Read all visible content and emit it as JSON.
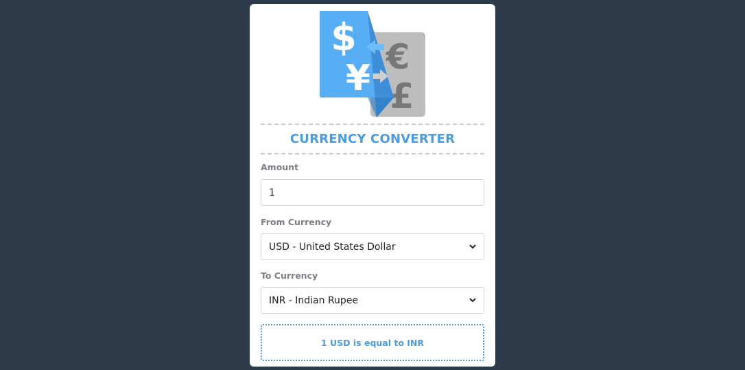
{
  "app": {
    "title": "CURRENCY CONVERTER",
    "logo_icon": "currency-exchange-icon"
  },
  "amount": {
    "label": "Amount",
    "value": "1"
  },
  "from_currency": {
    "label": "From Currency",
    "selected": "USD - United States Dollar"
  },
  "to_currency": {
    "label": "To Currency",
    "selected": "INR - Indian Rupee"
  },
  "result": {
    "text": "1 USD is equal to INR"
  },
  "colors": {
    "background": "#2d3a4a",
    "accent": "#4a9ce0",
    "card": "#ffffff"
  }
}
